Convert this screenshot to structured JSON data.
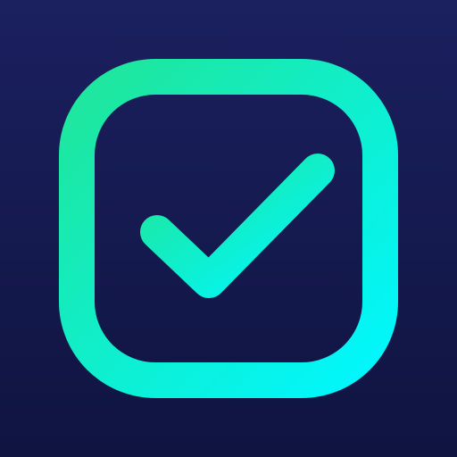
{
  "icon": {
    "name": "checkbox-checked-icon",
    "background": {
      "top": "#1b205f",
      "bottom": "#0f1440"
    },
    "accent": {
      "start": "#1fe69a",
      "end": "#00f7ff"
    }
  }
}
